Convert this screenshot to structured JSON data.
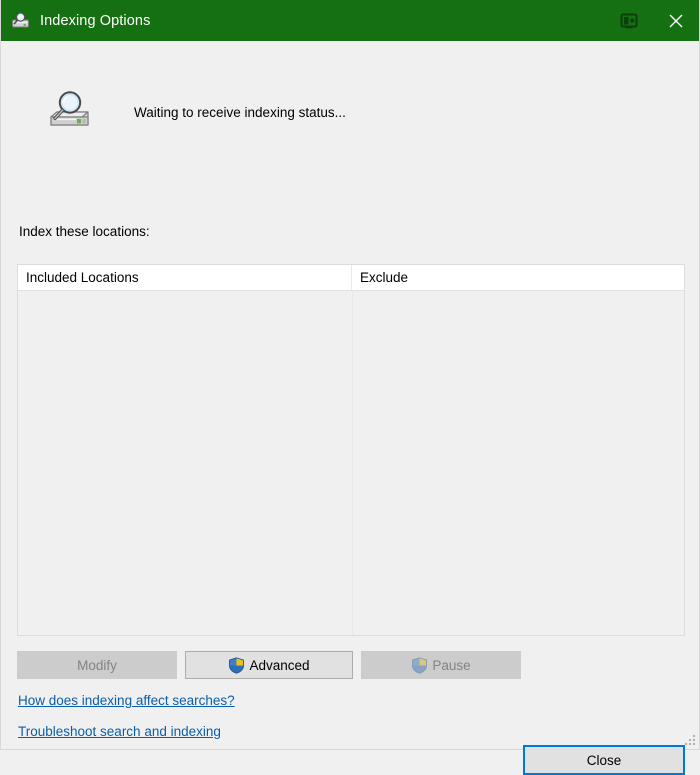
{
  "window": {
    "title": "Indexing Options",
    "title_icon": "indexing-options-icon",
    "titlebar_color": "#157012",
    "titlebar_text_color": "#ffffff",
    "background_color": "#f0f0f0"
  },
  "titlebar_buttons": {
    "display_icon": "monitor-icon",
    "close_icon": "close-icon"
  },
  "status": {
    "icon": "drive-search-icon",
    "text": "Waiting to receive indexing status..."
  },
  "locations": {
    "label": "Index these locations:",
    "columns": [
      {
        "key": "included",
        "label": "Included Locations"
      },
      {
        "key": "exclude",
        "label": "Exclude"
      }
    ],
    "rows": []
  },
  "buttons": {
    "modify": {
      "label": "Modify",
      "enabled": false,
      "shield": false
    },
    "advanced": {
      "label": "Advanced",
      "enabled": true,
      "shield": true
    },
    "pause": {
      "label": "Pause",
      "enabled": false,
      "shield": true
    },
    "close": {
      "label": "Close",
      "enabled": true,
      "is_default": true
    }
  },
  "links": [
    {
      "label": "How does indexing affect searches?"
    },
    {
      "label": "Troubleshoot search and indexing"
    }
  ],
  "colors": {
    "accent": "#0078d7",
    "link": "#0b5ea8",
    "title_green": "#157012",
    "disabled_text": "#838383"
  }
}
